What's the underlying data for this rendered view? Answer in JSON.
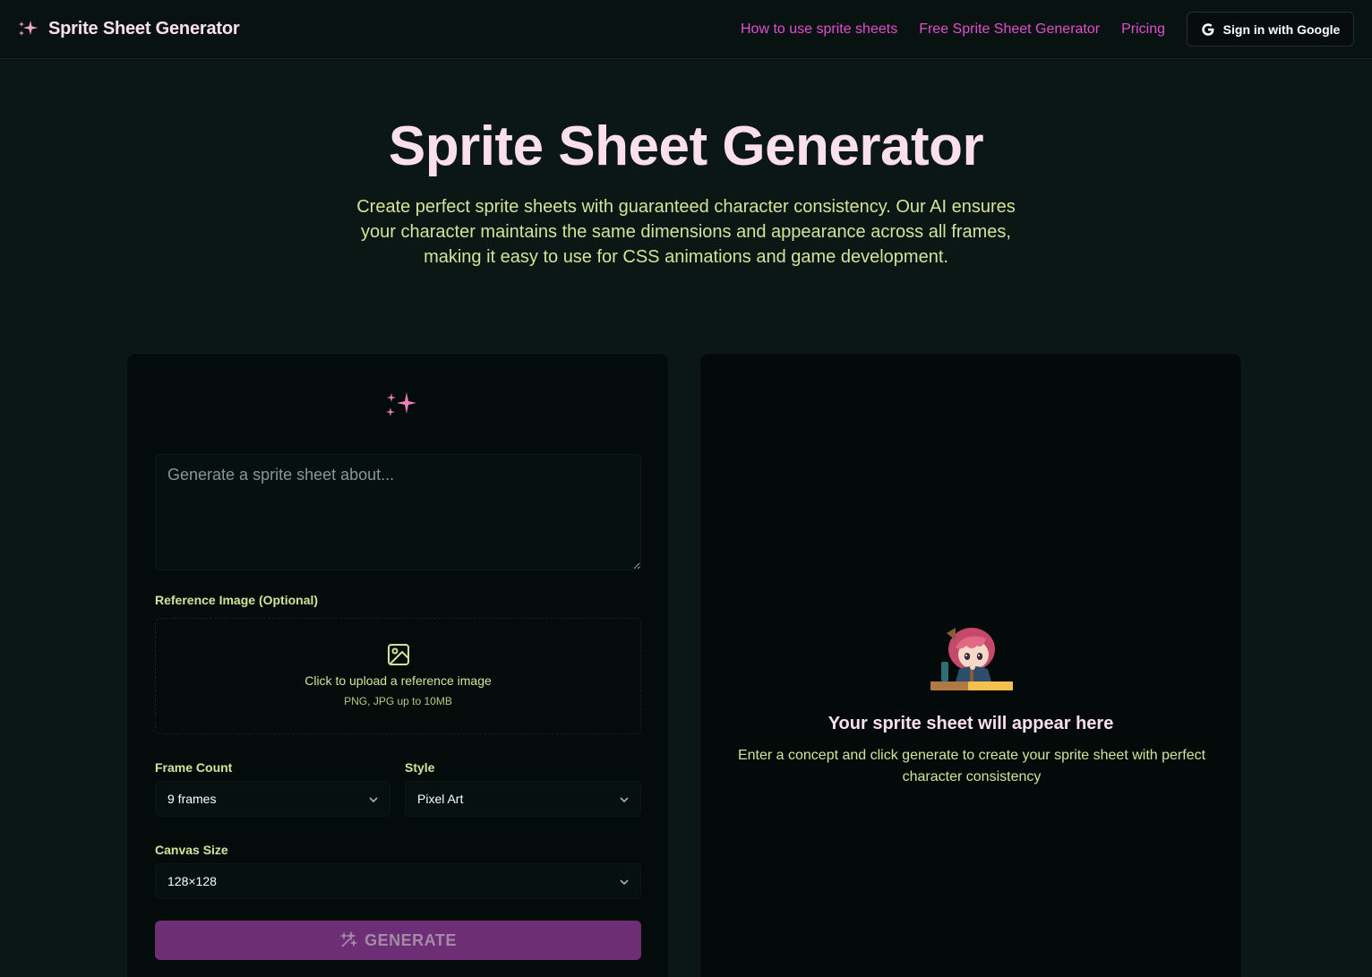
{
  "header": {
    "brand_title": "Sprite Sheet Generator",
    "nav": [
      {
        "label": "How to use sprite sheets"
      },
      {
        "label": "Free Sprite Sheet Generator"
      },
      {
        "label": "Pricing"
      }
    ],
    "sign_in_label": "Sign in with Google"
  },
  "hero": {
    "title": "Sprite Sheet Generator",
    "subtitle": "Create perfect sprite sheets with guaranteed character consistency. Our AI ensures your character maintains the same dimensions and appearance across all frames, making it easy to use for CSS animations and game development."
  },
  "form": {
    "prompt_placeholder": "Generate a sprite sheet about...",
    "prompt_value": "",
    "reference_label": "Reference Image (Optional)",
    "upload_text": "Click to upload a reference image",
    "upload_hint": "PNG, JPG up to 10MB",
    "frame_count_label": "Frame Count",
    "frame_count_value": "9 frames",
    "style_label": "Style",
    "style_value": "Pixel Art",
    "canvas_size_label": "Canvas Size",
    "canvas_size_value": "128×128",
    "generate_label": "GENERATE"
  },
  "preview": {
    "title": "Your sprite sheet will appear here",
    "subtitle": "Enter a concept and click generate to create your sprite sheet with perfect character consistency"
  },
  "colors": {
    "background": "#0a1715",
    "accent_pink": "#e04fcf",
    "title_pink": "#fbe0ec",
    "text_lime": "#d4e39a",
    "generate_button": "#6e2e76"
  },
  "icons": {
    "brand": "sparkles-icon",
    "upload": "image-icon",
    "select": "chevron-down-icon",
    "generate": "wand-sparkles-icon",
    "sign_in": "google-icon"
  }
}
